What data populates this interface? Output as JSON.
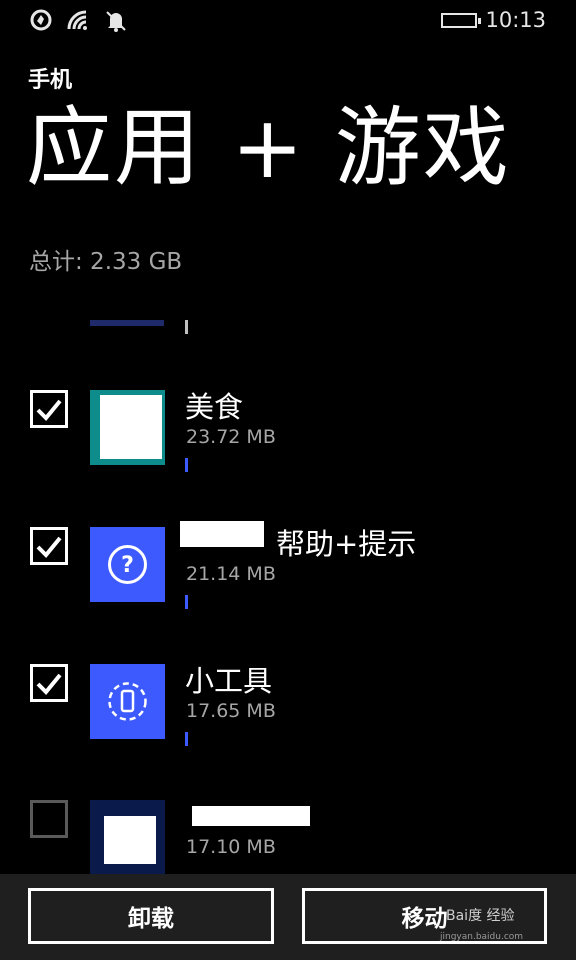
{
  "status_bar": {
    "time": "10:13",
    "icons": [
      "data-sense-icon",
      "wifi-icon",
      "quiet-hours-bell-icon",
      "battery-icon"
    ]
  },
  "header": {
    "subtitle": "手机",
    "title": "应用 + 游戏"
  },
  "total": "总计: 2.33 GB",
  "apps": [
    {
      "name": "美食",
      "size": "23.72 MB",
      "checked": true,
      "icon": "food-app-icon",
      "tile_color": "#ffffff",
      "border_color": "#0e8c8c"
    },
    {
      "name": "帮助+提示",
      "size": "21.14 MB",
      "checked": true,
      "icon": "help-question-icon",
      "tile_color": "#3d5afe"
    },
    {
      "name": "小工具",
      "size": "17.65 MB",
      "checked": true,
      "icon": "phone-tools-icon",
      "tile_color": "#3d5afe"
    },
    {
      "name": "",
      "size": "17.10 MB",
      "checked": false,
      "icon": "onedrive-icon",
      "tile_color": "#0a1a4a"
    }
  ],
  "actions": {
    "uninstall": "卸载",
    "move": "移动"
  },
  "watermark": {
    "line1": "Bai度 经验",
    "line2": "jingyan.baidu.com"
  }
}
